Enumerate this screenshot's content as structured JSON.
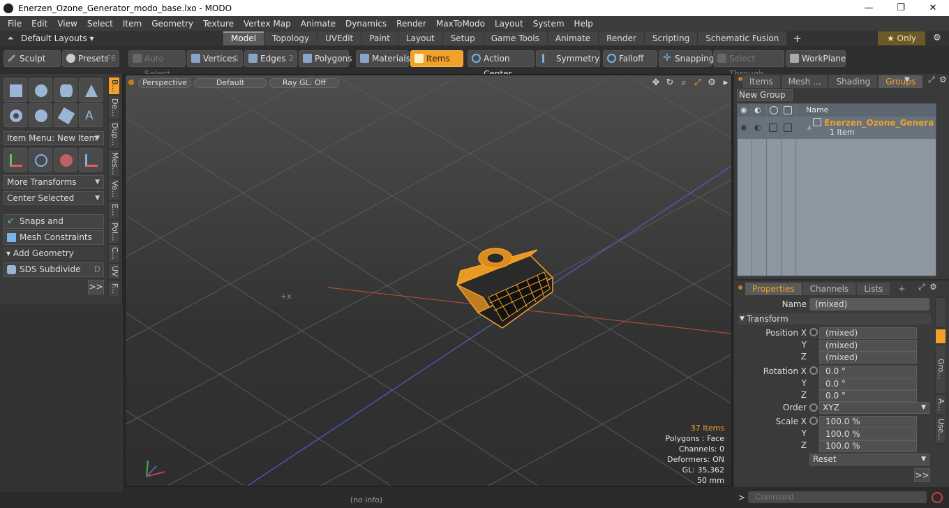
{
  "window": {
    "title": "Enerzen_Ozone_Generator_modo_base.lxo - MODO",
    "minimize": "—",
    "maximize": "❐",
    "close": "✕"
  },
  "menu": [
    "File",
    "Edit",
    "View",
    "Select",
    "Item",
    "Geometry",
    "Texture",
    "Vertex Map",
    "Animate",
    "Dynamics",
    "Render",
    "MaxToModo",
    "Layout",
    "System",
    "Help"
  ],
  "layout_bar": {
    "layouts": "Default Layouts ▾",
    "tabs": [
      "Model",
      "Topology",
      "UVEdit",
      "Paint",
      "Layout",
      "Setup",
      "Game Tools",
      "Animate",
      "Render",
      "Scripting",
      "Schematic Fusion"
    ],
    "active_tab": "Model",
    "plus": "+",
    "only": "★  Only",
    "cog": "⚙"
  },
  "toolbar": {
    "sculpt": "Sculpt",
    "presets": "Presets",
    "presets_shortcut": "F6",
    "auto_select": "Auto Select",
    "vertices": "Vertices",
    "vertices_shortcut": "1",
    "edges": "Edges",
    "edges_shortcut": "2",
    "polygons": "Polygons",
    "materials": "Materials",
    "items": "Items",
    "action_center": "Action Center",
    "symmetry": "Symmetry",
    "falloff": "Falloff",
    "snapping": "Snapping",
    "select_through": "Select Through",
    "workplane": "WorkPlane"
  },
  "left_panel": {
    "item_menu": "Item Menu: New Item",
    "more_transforms": "More Transforms",
    "center_selected": "Center Selected",
    "snaps": "Snaps and Precision",
    "mesh_constraints": "Mesh Constraints",
    "add_geometry": "Add Geometry",
    "sds_subdivide": "SDS Subdivide",
    "sds_shortcut": "D",
    "more": ">>",
    "vtabs": [
      "B...",
      "De...",
      "Dup...",
      "Mes...",
      "Ve...",
      "E...",
      "Pol...",
      "C...",
      "UV",
      "F..."
    ]
  },
  "viewport": {
    "perspective": "Perspective",
    "default": "Default",
    "raygl": "Ray GL: Off",
    "info": {
      "items": "37 Items",
      "polygons": "Polygons : Face",
      "channels": "Channels: 0",
      "deformers": "Deformers: ON",
      "gl": "GL: 35,362",
      "focal": "50 mm"
    }
  },
  "status_bar": "(no info)",
  "groups_panel": {
    "tabs": [
      "Items",
      "Mesh ...",
      "Shading",
      "Groups"
    ],
    "active_tab": "Groups",
    "new_group": "New Group",
    "col_name": "Name",
    "row_name": "Enerzen_Ozone_Generator",
    "row_count": "1 Item"
  },
  "properties_panel": {
    "tabs": [
      "Properties",
      "Channels",
      "Lists"
    ],
    "active_tab": "Properties",
    "plus": "+",
    "name_label": "Name",
    "name_value": "(mixed)",
    "transform": "Transform",
    "position_label": "Position X",
    "position": [
      "(mixed)",
      "(mixed)",
      "(mixed)"
    ],
    "rotation_label": "Rotation X",
    "rotation": [
      "0.0 °",
      "0.0 °",
      "0.0 °"
    ],
    "order_label": "Order",
    "order_value": "XYZ",
    "scale_label": "Scale X",
    "scale": [
      "100.0 %",
      "100.0 %",
      "100.0 %"
    ],
    "y_label": "Y",
    "z_label": "Z",
    "reset": "Reset",
    "more": ">>",
    "rvtabs": [
      "Gro...",
      "A...",
      "Use..."
    ]
  },
  "command": {
    "prompt": ">",
    "placeholder": "Command"
  },
  "colors": {
    "accent": "#f2a12b",
    "panel": "#3a3a3a",
    "group_list": "#8c97a2"
  }
}
